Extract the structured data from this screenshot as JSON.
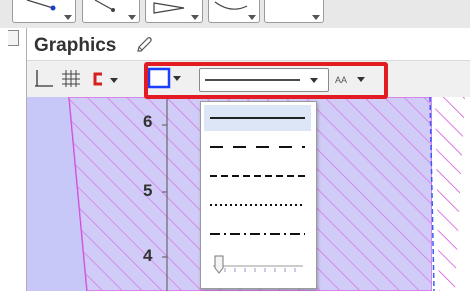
{
  "graphics": {
    "title": "Graphics"
  },
  "axis": {
    "ticks": [
      "6",
      "5",
      "4"
    ]
  },
  "line_style_menu": {
    "options": [
      "solid",
      "long-dash",
      "dashed",
      "dotted",
      "dash-dot"
    ],
    "selected": "solid"
  },
  "colors": {
    "highlight": "#e31b23",
    "region_fill": "#c8c8f8",
    "hatch": "#d040d8",
    "blue_box": "#1a3fff",
    "point_color": "#d62020"
  },
  "icons": [
    "pencil-icon",
    "axes-icon",
    "grid-icon",
    "point-capture-icon",
    "color-swatch-icon",
    "text-size-icon"
  ]
}
